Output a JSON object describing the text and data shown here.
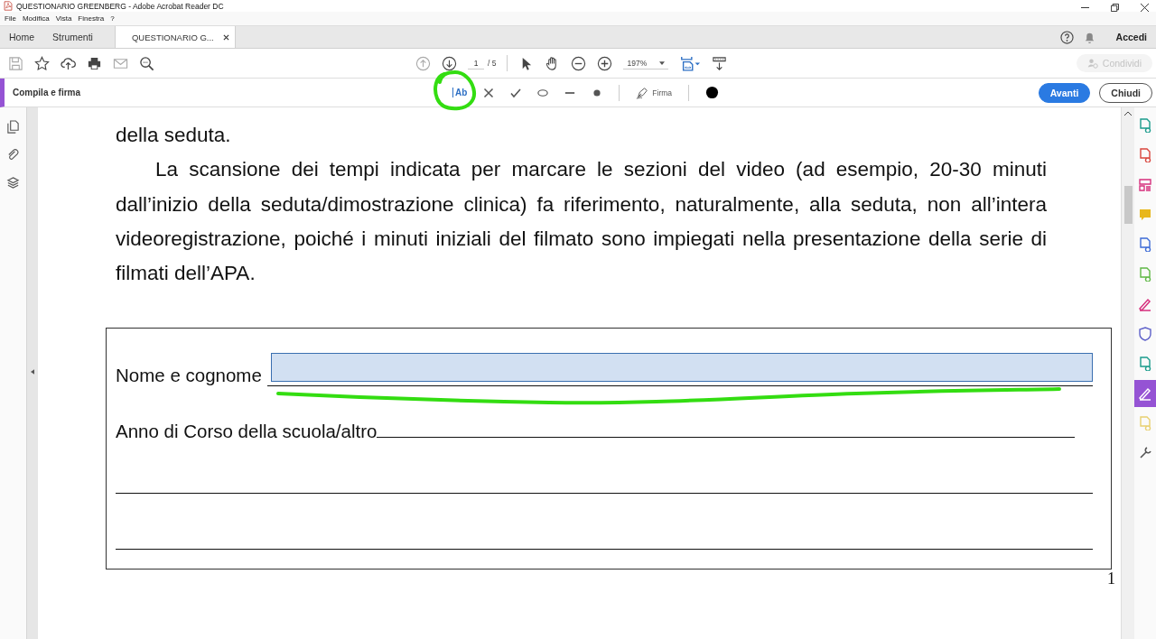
{
  "window": {
    "title": "QUESTIONARIO GREENBERG - Adobe Acrobat Reader DC"
  },
  "menu": [
    "File",
    "Modifica",
    "Vista",
    "Finestra",
    "?"
  ],
  "tabs": [
    {
      "label": "Home",
      "selected": false
    },
    {
      "label": "Strumenti",
      "selected": false
    },
    {
      "label": "QUESTIONARIO G...",
      "selected": true
    }
  ],
  "top_right": {
    "signin": "Accedi"
  },
  "toolbar": {
    "page": "1",
    "page_total": "/ 5",
    "zoom": "197%",
    "share": {
      "label": "Condividi",
      "disabled": true
    }
  },
  "fill_sign": {
    "title": "Compila e firma",
    "tools": [
      {
        "kind": "text",
        "label": "Ab",
        "selected": true
      },
      {
        "kind": "cross"
      },
      {
        "kind": "check"
      },
      {
        "kind": "ellipse"
      },
      {
        "kind": "line"
      },
      {
        "kind": "dot"
      },
      {
        "kind": "sign",
        "label": "Firma",
        "selected": false
      },
      {
        "kind": "color",
        "color": "#000000"
      }
    ],
    "buttons": [
      {
        "label": "Avanti",
        "kind": "primary"
      },
      {
        "label": "Chiudi",
        "kind": "secondary"
      }
    ]
  },
  "right_tools": [
    {
      "kind": "export",
      "selected": false
    },
    {
      "kind": "create",
      "selected": false
    },
    {
      "kind": "organize",
      "selected": false
    },
    {
      "kind": "comment",
      "selected": false
    },
    {
      "kind": "combine",
      "selected": false
    },
    {
      "kind": "compress",
      "selected": false
    },
    {
      "kind": "edit",
      "selected": false
    },
    {
      "kind": "protect",
      "selected": false
    },
    {
      "kind": "scan",
      "selected": false
    },
    {
      "kind": "fillsign",
      "selected": true
    },
    {
      "kind": "send",
      "selected": false
    },
    {
      "kind": "more",
      "selected": false
    }
  ],
  "document": {
    "paragraphs": [
      {
        "text": "della seduta.",
        "indent": false
      },
      {
        "text": "La scansione dei tempi indicata per marcare le sezioni del video (ad esempio, 20-30 minuti dall’inizio della seduta/dimostrazione clinica) fa riferimento, naturalmente, alla seduta, non all’intera videoregistrazione, poiché i minuti iniziali del filmato sono impiegati nella presentazione della serie di filmati dell’APA.",
        "indent": true
      }
    ],
    "form": [
      {
        "kind": "field",
        "label": "Nome e cognome",
        "focused": true
      },
      {
        "kind": "line",
        "label": "Anno di Corso della scuola/altro"
      },
      {
        "kind": "blank"
      },
      {
        "kind": "blank"
      }
    ],
    "page_number": "1"
  }
}
